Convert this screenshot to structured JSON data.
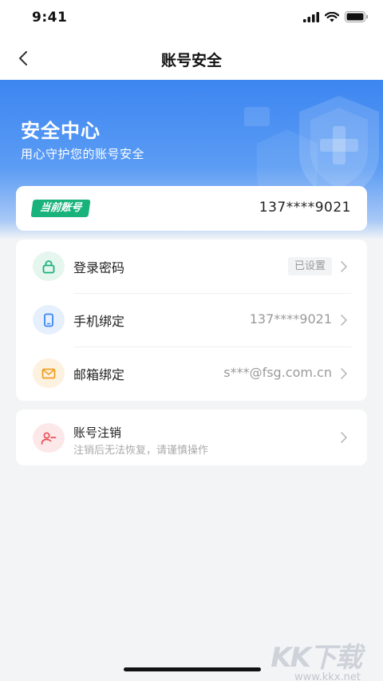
{
  "status_bar": {
    "time": "9:41"
  },
  "nav": {
    "title": "账号安全"
  },
  "hero": {
    "title": "安全中心",
    "subtitle": "用心守护您的账号安全"
  },
  "account": {
    "tag": "当前账号",
    "number": "137****9021"
  },
  "security_items": [
    {
      "label": "登录密码",
      "value": "已设置",
      "icon": "lock-icon",
      "color": "#19b27b"
    },
    {
      "label": "手机绑定",
      "value": "137****9021",
      "icon": "phone-icon",
      "color": "#3d86f1"
    },
    {
      "label": "邮箱绑定",
      "value": "s***@fsg.com.cn",
      "icon": "mail-icon",
      "color": "#f0a023"
    }
  ],
  "cancel": {
    "title": "账号注销",
    "subtitle": "注销后无法恢复，请谨慎操作",
    "icon": "user-remove-icon",
    "color": "#e8525a"
  },
  "watermark": {
    "text": "KK下载",
    "url": "www.kkx.net"
  }
}
